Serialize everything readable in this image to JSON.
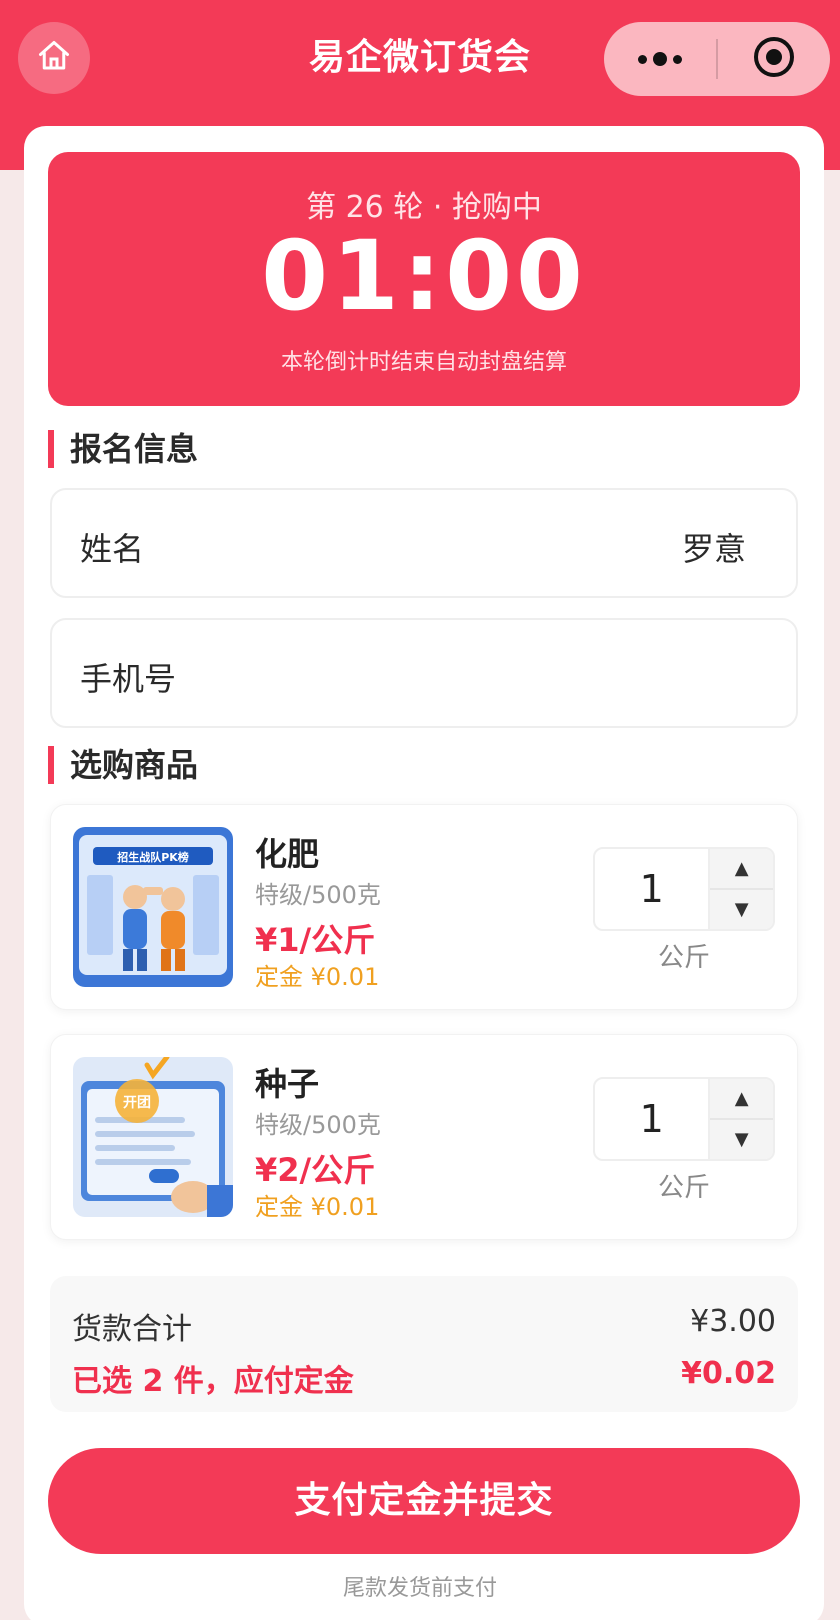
{
  "header": {
    "title": "易企微订货会",
    "home_icon": "home-icon",
    "more_icon": "more-dots-icon",
    "target_icon": "target-circle-icon"
  },
  "timer": {
    "round": "第 26 轮 · 抢购中",
    "clock": "01:00",
    "note": "本轮倒计时结束自动封盘结算"
  },
  "signup": {
    "title": "报名信息",
    "name_label": "姓名",
    "name_value": "罗意",
    "phone_label": "手机号",
    "phone_value": ""
  },
  "products": {
    "title": "选购商品",
    "items": [
      {
        "name": "化肥",
        "spec": "特级/500克",
        "price": "¥1/公斤",
        "deposit": "定金 ¥0.01",
        "qty": "1",
        "unit": "公斤",
        "thumb_text": "招生战队PK榜"
      },
      {
        "name": "种子",
        "spec": "特级/500克",
        "price": "¥2/公斤",
        "deposit": "定金 ¥0.01",
        "qty": "1",
        "unit": "公斤",
        "thumb_text": "开团"
      }
    ]
  },
  "summary": {
    "total_label": "货款合计",
    "total_value": "¥3.00",
    "selected_label": "已选 2 件，应付定金",
    "deposit_value": "¥0.02"
  },
  "actions": {
    "submit_label": "支付定金并提交",
    "hint": "尾款发货前支付"
  },
  "colors": {
    "brand": "#f33a57",
    "price": "#f0304e",
    "deposit": "#f0a020"
  }
}
